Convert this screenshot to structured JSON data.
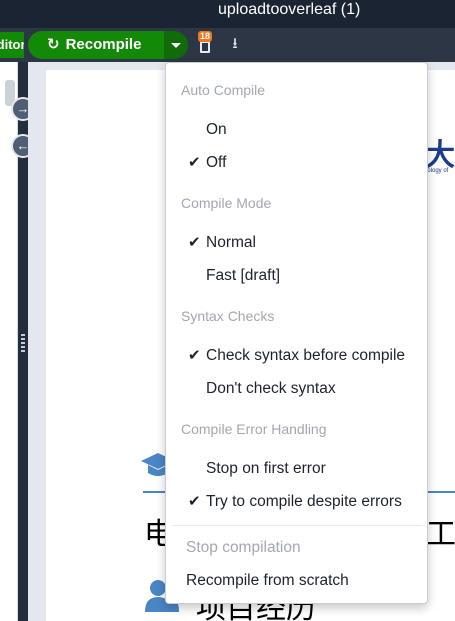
{
  "window": {
    "title": "uploadtooverleaf (1)"
  },
  "toolbar": {
    "editor_tab_label": "Editor",
    "recompile_label": "Recompile",
    "recompile_icon": "refresh-icon",
    "logs_badge_count": "18",
    "logs_icon": "document-icon",
    "download_icon": "download-icon"
  },
  "compile_menu": {
    "sections": [
      {
        "header": "Auto Compile",
        "items": [
          {
            "label": "On",
            "checked": false
          },
          {
            "label": "Off",
            "checked": true
          }
        ]
      },
      {
        "header": "Compile Mode",
        "items": [
          {
            "label": "Normal",
            "checked": true
          },
          {
            "label": "Fast [draft]",
            "checked": false
          }
        ]
      },
      {
        "header": "Syntax Checks",
        "items": [
          {
            "label": "Check syntax before compile",
            "checked": true
          },
          {
            "label": "Don't check syntax",
            "checked": false
          }
        ]
      },
      {
        "header": "Compile Error Handling",
        "items": [
          {
            "label": "Stop on first error",
            "checked": false
          },
          {
            "label": "Try to compile despite errors",
            "checked": true
          }
        ]
      }
    ],
    "actions": {
      "stop_label": "Stop compilation",
      "recompile_scratch_label": "Recompile from scratch"
    }
  },
  "pdf_preview": {
    "logo_text": "大",
    "logo_subtext": "nology of",
    "heading_left": "电",
    "heading_right": "工",
    "heading2": "项目经历"
  },
  "colors": {
    "compile_green": "#138a07",
    "titlebar": "#1b2433",
    "toolbar": "#2c3645",
    "badge": "#f0781e",
    "menu_header_grey": "#a1a8b1",
    "accent_blue": "#4a86c5"
  }
}
